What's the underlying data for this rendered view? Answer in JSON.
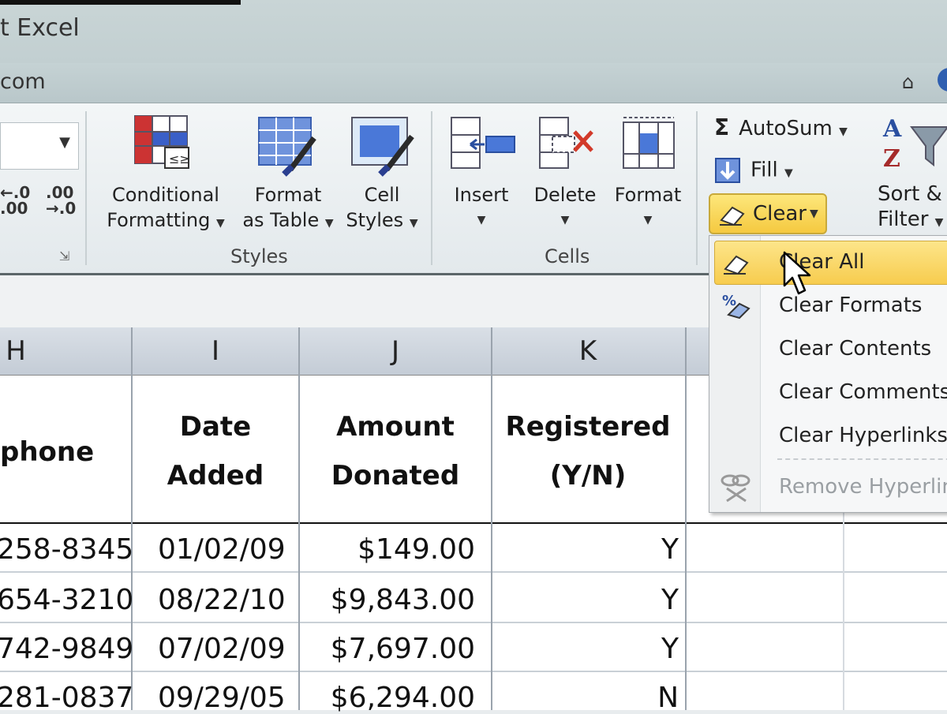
{
  "window": {
    "title": "t Excel",
    "url_fragment": "com"
  },
  "ribbon": {
    "number_group": {
      "decimal_increase": "←.0\n.00",
      "decimal_decrease": ".00\n→.0"
    },
    "styles_group": {
      "label": "Styles",
      "conditional_formatting": [
        "Conditional",
        "Formatting"
      ],
      "format_as_table": [
        "Format",
        "as Table"
      ],
      "cell_styles": [
        "Cell",
        "Styles"
      ]
    },
    "cells_group": {
      "label": "Cells",
      "insert": "Insert",
      "delete": "Delete",
      "format": "Format"
    },
    "editing_group": {
      "autosum": "AutoSum",
      "fill": "Fill",
      "clear": "Clear",
      "sort_filter": [
        "Sort &",
        "Filter"
      ]
    }
  },
  "clear_menu": {
    "items": [
      "Clear All",
      "Clear Formats",
      "Clear Contents",
      "Clear Comments",
      "Clear Hyperlinks",
      "Remove Hyperlin"
    ],
    "highlighted": "Clear All",
    "disabled": [
      "Remove Hyperlin"
    ]
  },
  "sheet": {
    "columns": [
      "H",
      "I",
      "J",
      "K"
    ],
    "headers": {
      "phone": "phone",
      "date_added": [
        "Date",
        "Added"
      ],
      "amount": [
        "Amount",
        "Donated"
      ],
      "registered": [
        "Registered",
        "(Y/N)"
      ]
    },
    "rows": [
      [
        "258-8345",
        "01/02/09",
        "$149.00",
        "Y"
      ],
      [
        "654-3210",
        "08/22/10",
        "$9,843.00",
        "Y"
      ],
      [
        "742-9849",
        "07/02/09",
        "$7,697.00",
        "Y"
      ],
      [
        "281-0837",
        "09/29/05",
        "$6,294.00",
        "N"
      ]
    ]
  }
}
